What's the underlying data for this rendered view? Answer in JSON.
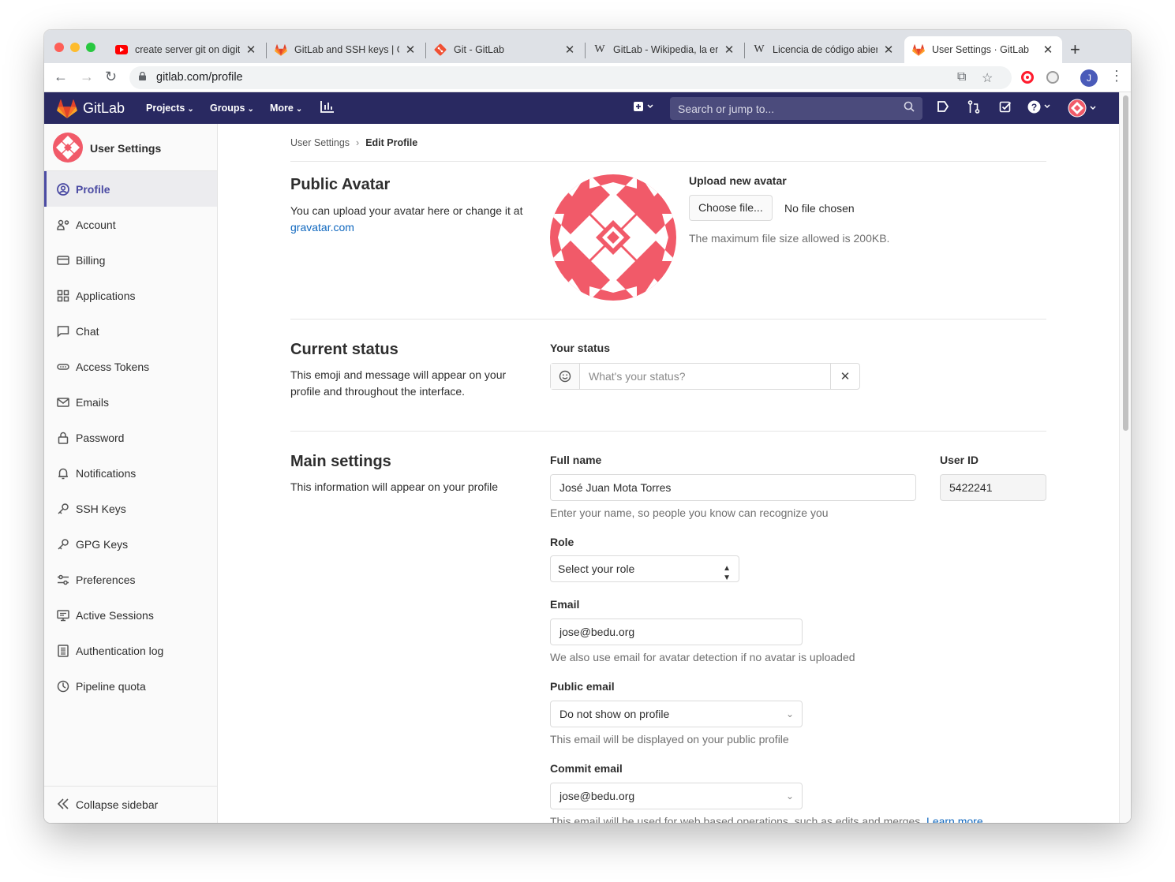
{
  "browser": {
    "tabs": [
      {
        "title": "create server git on digital",
        "favicon": "youtube-icon"
      },
      {
        "title": "GitLab and SSH keys | GitLab",
        "favicon": "gitlab-icon"
      },
      {
        "title": "Git - GitLab",
        "favicon": "git-icon"
      },
      {
        "title": "GitLab - Wikipedia, la enciclopedia",
        "favicon": "wikipedia-icon"
      },
      {
        "title": "Licencia de código abierto",
        "favicon": "wikipedia-icon"
      },
      {
        "title": "User Settings · GitLab",
        "favicon": "gitlab-icon"
      }
    ],
    "active_tab": 5,
    "url": "gitlab.com/profile",
    "profile_initial": "J"
  },
  "navbar": {
    "brand": "GitLab",
    "menus": [
      "Projects",
      "Groups",
      "More"
    ],
    "search_placeholder": "Search or jump to..."
  },
  "sidebar": {
    "title": "User Settings",
    "items": [
      {
        "label": "Profile",
        "icon": "profile-icon",
        "active": true
      },
      {
        "label": "Account",
        "icon": "account-icon"
      },
      {
        "label": "Billing",
        "icon": "billing-icon"
      },
      {
        "label": "Applications",
        "icon": "applications-icon"
      },
      {
        "label": "Chat",
        "icon": "chat-icon"
      },
      {
        "label": "Access Tokens",
        "icon": "token-icon"
      },
      {
        "label": "Emails",
        "icon": "email-icon"
      },
      {
        "label": "Password",
        "icon": "lock-icon"
      },
      {
        "label": "Notifications",
        "icon": "bell-icon"
      },
      {
        "label": "SSH Keys",
        "icon": "key-icon"
      },
      {
        "label": "GPG Keys",
        "icon": "key-icon"
      },
      {
        "label": "Preferences",
        "icon": "preferences-icon"
      },
      {
        "label": "Active Sessions",
        "icon": "monitor-icon"
      },
      {
        "label": "Authentication log",
        "icon": "log-icon"
      },
      {
        "label": "Pipeline quota",
        "icon": "quota-icon"
      }
    ],
    "collapse_label": "Collapse sidebar"
  },
  "breadcrumb": {
    "parent": "User Settings",
    "current": "Edit Profile"
  },
  "avatar_section": {
    "title": "Public Avatar",
    "description": "You can upload your avatar here or change it at",
    "link": "gravatar.com",
    "upload_label": "Upload new avatar",
    "choose_button": "Choose file...",
    "no_file": "No file chosen",
    "help": "The maximum file size allowed is 200KB."
  },
  "status_section": {
    "title": "Current status",
    "description": "This emoji and message will appear on your profile and throughout the interface.",
    "label": "Your status",
    "placeholder": "What's your status?"
  },
  "main_section": {
    "title": "Main settings",
    "description": "This information will appear on your profile",
    "full_name_label": "Full name",
    "full_name": "José Juan Mota Torres",
    "full_name_help": "Enter your name, so people you know can recognize you",
    "user_id_label": "User ID",
    "user_id": "5422241",
    "role_label": "Role",
    "role_value": "Select your role",
    "email_label": "Email",
    "email": "jose@bedu.org",
    "email_help": "We also use email for avatar detection if no avatar is uploaded",
    "public_email_label": "Public email",
    "public_email": "Do not show on profile",
    "public_email_help": "This email will be displayed on your public profile",
    "commit_email_label": "Commit email",
    "commit_email": "jose@bedu.org",
    "commit_email_help": "This email will be used for web based operations, such as edits and merges.",
    "learn_more": "Learn more"
  },
  "colors": {
    "navbar": "#292961",
    "avatar": "#f15a69",
    "link": "#1068bf",
    "active_sidebar_border": "#4b4ba3"
  }
}
